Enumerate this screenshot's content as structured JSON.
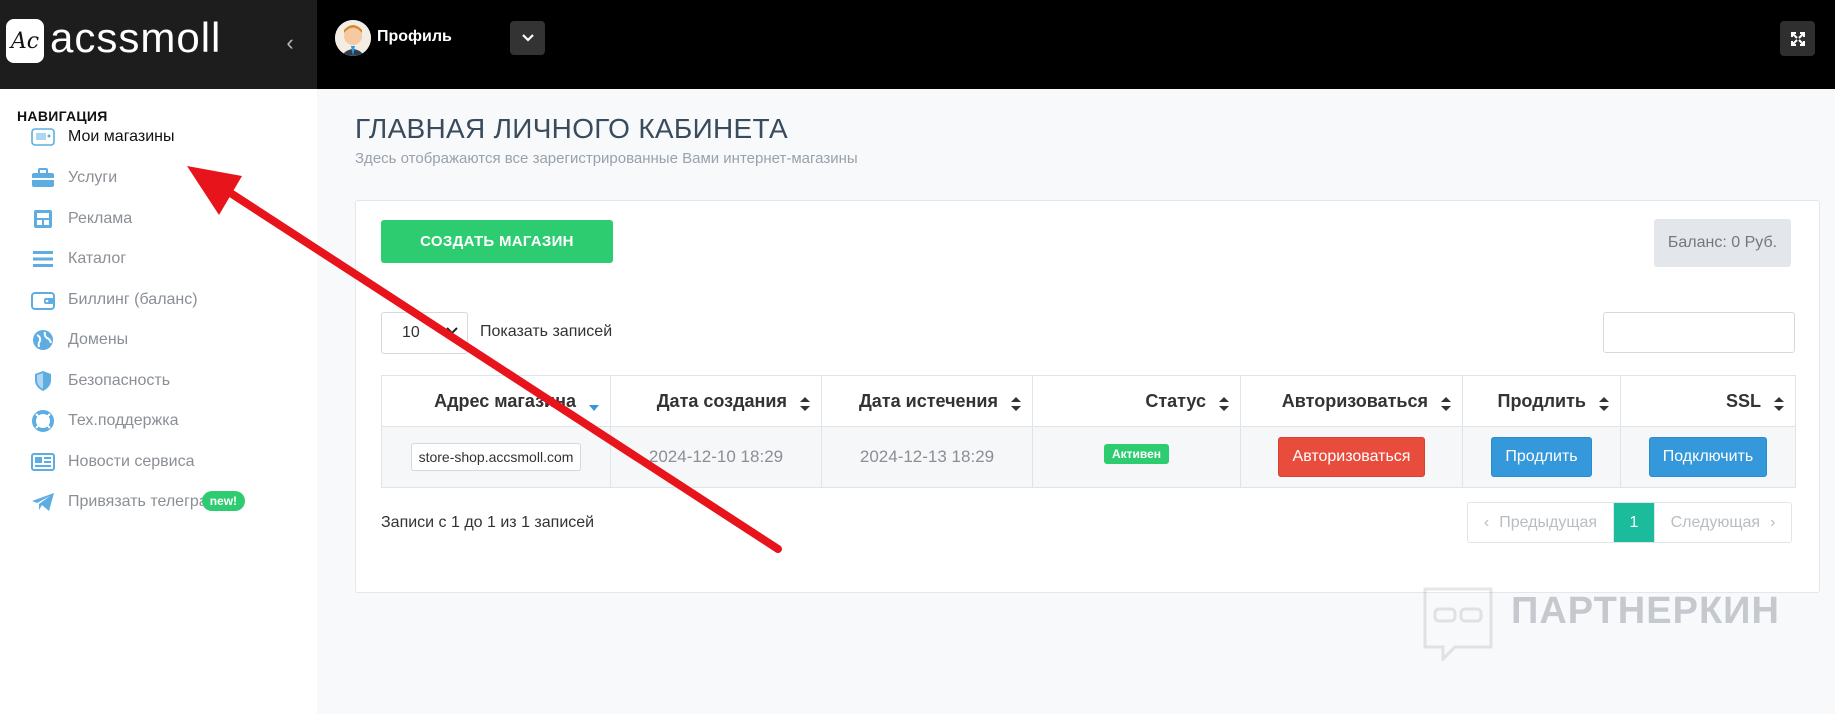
{
  "brand": {
    "badge": "Ac",
    "name": "acssmoll"
  },
  "header": {
    "collapse_glyph": "‹",
    "profile_label": "Профиль",
    "icons": [
      "chevron-down-icon",
      "fullscreen-icon"
    ]
  },
  "sidebar": {
    "title": "НАВИГАЦИЯ",
    "items": [
      {
        "label": "Мои магазины",
        "icon": "shop-icon",
        "active": true
      },
      {
        "label": "Услуги",
        "icon": "briefcase-icon"
      },
      {
        "label": "Реклама",
        "icon": "ads-icon"
      },
      {
        "label": "Каталог",
        "icon": "list-icon"
      },
      {
        "label": "Биллинг (баланс)",
        "icon": "wallet-icon"
      },
      {
        "label": "Домены",
        "icon": "globe-icon"
      },
      {
        "label": "Безопасность",
        "icon": "shield-icon"
      },
      {
        "label": "Тех.поддержка",
        "icon": "lifebuoy-icon"
      },
      {
        "label": "Новости сервиса",
        "icon": "newspaper-icon"
      },
      {
        "label": "Привязать телегра",
        "icon": "telegram-icon",
        "badge": "new!"
      }
    ]
  },
  "main": {
    "title": "ГЛАВНАЯ ЛИЧНОГО КАБИНЕТА",
    "subtitle": "Здесь отображаются все зарегистрированные Вами интернет-магазины",
    "create_button": "СОЗДАТЬ МАГАЗИН",
    "balance": "Баланс: 0 Руб.",
    "page_length": "10",
    "page_length_label": "Показать записей",
    "table": {
      "columns": [
        "Адрес магазина",
        "Дата создания",
        "Дата истечения",
        "Статус",
        "Авторизоваться",
        "Продлить",
        "SSL"
      ],
      "rows": [
        {
          "address": "store-shop.accsmoll.com",
          "created": "2024-12-10 18:29",
          "expires": "2024-12-13 18:29",
          "status": "Активен",
          "login_button": "Авторизоваться",
          "renew_button": "Продлить",
          "ssl_button": "Подключить"
        }
      ]
    },
    "info": "Записи с 1 до 1 из 1 записей",
    "pager": {
      "prev": "Предыдущая",
      "current": "1",
      "next": "Следующая",
      "prev_glyph": "‹",
      "next_glyph": "›"
    }
  },
  "watermark": "ПАРТНЕРКИН",
  "colors": {
    "green": "#2ecc71",
    "red": "#e74c3c",
    "blue": "#3498db",
    "teal": "#1abc9c",
    "arrow": "#e8141b"
  }
}
